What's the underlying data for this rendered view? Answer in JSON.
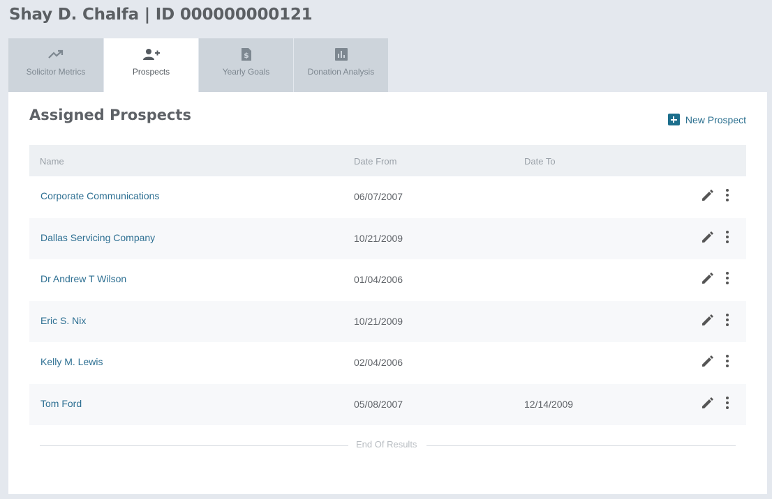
{
  "header": {
    "title": "Shay D. Chalfa | ID 000000000121"
  },
  "tabs": [
    {
      "label": "Solicitor Metrics",
      "icon": "trending-up-icon",
      "active": false
    },
    {
      "label": "Prospects",
      "icon": "add-person-icon",
      "active": true
    },
    {
      "label": "Yearly Goals",
      "icon": "dollar-document-icon",
      "active": false
    },
    {
      "label": "Donation Analysis",
      "icon": "bar-chart-icon",
      "active": false
    }
  ],
  "panel": {
    "title": "Assigned Prospects",
    "new_button_label": "New Prospect"
  },
  "table": {
    "columns": {
      "name": "Name",
      "from": "Date From",
      "to": "Date To"
    },
    "rows": [
      {
        "name": "Corporate Communications",
        "from": "06/07/2007",
        "to": ""
      },
      {
        "name": "Dallas Servicing Company",
        "from": "10/21/2009",
        "to": ""
      },
      {
        "name": "Dr Andrew T Wilson",
        "from": "01/04/2006",
        "to": ""
      },
      {
        "name": "Eric S. Nix",
        "from": "10/21/2009",
        "to": ""
      },
      {
        "name": "Kelly M. Lewis",
        "from": "02/04/2006",
        "to": ""
      },
      {
        "name": "Tom Ford",
        "from": "05/08/2007",
        "to": "12/14/2009"
      }
    ],
    "end_label": "End Of Results"
  },
  "colors": {
    "accent": "#1c6e8c",
    "link": "#2d6f92",
    "background": "#e4e8ee",
    "tab_inactive": "#cdd4db"
  }
}
